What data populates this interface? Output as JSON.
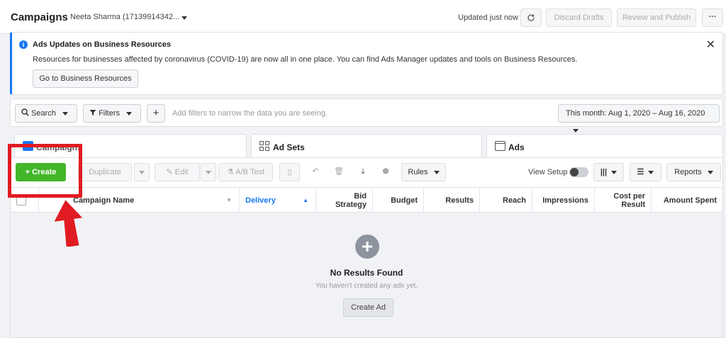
{
  "topbar": {
    "title": "Campaigns",
    "account": "Neeta Sharma (17139914342...",
    "updated": "Updated just now",
    "refresh_icon": "refresh-icon",
    "discard": "Discard Drafts",
    "review": "Review and Publish",
    "more": "···"
  },
  "banner": {
    "title": "Ads Updates on Business Resources",
    "text": "Resources for businesses affected by coronavirus (COVID-19) are now all in one place. You can find Ads Manager updates and tools on Business Resources.",
    "button": "Go to Business Resources",
    "close": "✕"
  },
  "filters": {
    "search": "Search",
    "filters": "Filters",
    "plus": "+",
    "hint": "Add filters to narrow the data you are seeing.",
    "date": "This month: Aug 1, 2020 – Aug 16, 2020"
  },
  "tabs": [
    {
      "label": "Campaigns"
    },
    {
      "label": "Ad Sets"
    },
    {
      "label": "Ads"
    }
  ],
  "toolbar": {
    "create": "+ Create",
    "duplicate": "Duplicate",
    "edit": "Edit",
    "ab_test": "A/B Test",
    "rules": "Rules",
    "view_setup": "View Setup",
    "reports": "Reports"
  },
  "columns": {
    "campaign_name": "Campaign Name",
    "delivery": "Delivery",
    "bid_strategy": "Bid Strategy",
    "budget": "Budget",
    "results": "Results",
    "reach": "Reach",
    "impressions": "Impressions",
    "cost_per_result": "Cost per Result",
    "amount_spent": "Amount Spent"
  },
  "empty_state": {
    "title": "No Results Found",
    "subtitle": "You haven't created any ads yet.",
    "button": "Create Ad"
  },
  "colors": {
    "accent": "#1877f2",
    "create_green": "#42b72a",
    "annotation_red": "#e11b22"
  }
}
